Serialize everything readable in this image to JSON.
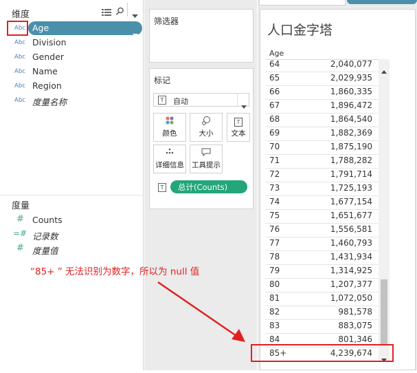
{
  "data_pane": {
    "dimensions_header": "维度",
    "measures_header": "度量",
    "dimensions": [
      {
        "type": "Abc",
        "name": "Age",
        "selected": true
      },
      {
        "type": "Abc",
        "name": "Division"
      },
      {
        "type": "Abc",
        "name": "Gender"
      },
      {
        "type": "Abc",
        "name": "Name"
      },
      {
        "type": "Abc",
        "name": "Region"
      },
      {
        "type": "Abc",
        "name": "度量名称",
        "italic": true
      }
    ],
    "measures": [
      {
        "type": "#",
        "name": "Counts"
      },
      {
        "type": "=#",
        "name": "记录数",
        "italic": true
      },
      {
        "type": "#",
        "name": "度量值",
        "italic": true
      }
    ],
    "icons": [
      "grid-view-icon",
      "search-icon",
      "dropdown-icon"
    ]
  },
  "shelves": {
    "filters_title": "筛选器",
    "marks_title": "标记",
    "mark_type": "自动",
    "mark_buttons": [
      {
        "label": "颜色",
        "icon": "color-dots-icon"
      },
      {
        "label": "大小",
        "icon": "size-icon"
      },
      {
        "label": "文本",
        "icon": "text-icon"
      },
      {
        "label": "详细信息",
        "icon": "detail-icon"
      },
      {
        "label": "工具提示",
        "icon": "tooltip-icon"
      }
    ],
    "pill": "总计(Counts)"
  },
  "view": {
    "title": "人口金字塔",
    "column_header": "Age",
    "rows": [
      {
        "age": "64",
        "count": "2,040,077"
      },
      {
        "age": "65",
        "count": "2,029,935"
      },
      {
        "age": "66",
        "count": "1,860,335"
      },
      {
        "age": "67",
        "count": "1,896,472"
      },
      {
        "age": "68",
        "count": "1,864,540"
      },
      {
        "age": "69",
        "count": "1,882,369"
      },
      {
        "age": "70",
        "count": "1,875,190"
      },
      {
        "age": "71",
        "count": "1,788,282"
      },
      {
        "age": "72",
        "count": "1,791,714"
      },
      {
        "age": "73",
        "count": "1,725,193"
      },
      {
        "age": "74",
        "count": "1,677,154"
      },
      {
        "age": "75",
        "count": "1,651,677"
      },
      {
        "age": "76",
        "count": "1,556,581"
      },
      {
        "age": "77",
        "count": "1,460,793"
      },
      {
        "age": "78",
        "count": "1,431,934"
      },
      {
        "age": "79",
        "count": "1,314,925"
      },
      {
        "age": "80",
        "count": "1,207,377"
      },
      {
        "age": "81",
        "count": "1,072,050"
      },
      {
        "age": "82",
        "count": "981,578"
      },
      {
        "age": "83",
        "count": "883,075"
      },
      {
        "age": "84",
        "count": "801,346"
      },
      {
        "age": "85+",
        "count": "4,239,674"
      }
    ]
  },
  "annotation": {
    "text": "“85+ ”  无法识别为数字，所以为 null 值",
    "color": "#e02020"
  },
  "colors": {
    "selected_pill": "#4a90ab",
    "measure_pill": "#22a67a",
    "annotation_red": "#e02020"
  }
}
